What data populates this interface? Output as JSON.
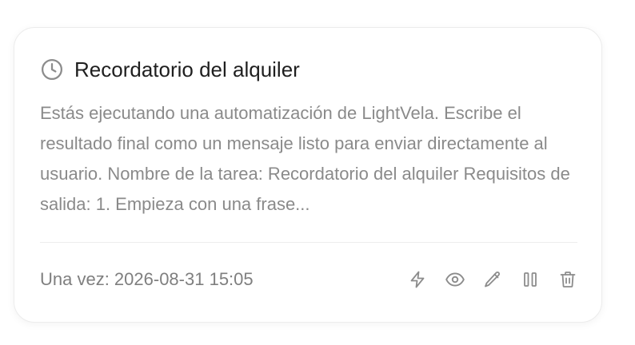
{
  "task": {
    "title": "Recordatorio del alquiler",
    "description": "Estás ejecutando una automatización de LightVela. Escribe el resultado final como un mensaje listo para enviar directamente al usuario. Nombre de la tarea: Recordatorio del alquiler Requisitos de salida: 1. Empieza con una frase...",
    "schedule": "Una vez: 2026-08-31 15:05",
    "title_icon": "clock-icon"
  },
  "actions": [
    {
      "icon": "bolt-icon"
    },
    {
      "icon": "eye-icon"
    },
    {
      "icon": "pencil-icon"
    },
    {
      "icon": "pause-icon"
    },
    {
      "icon": "trash-icon"
    }
  ],
  "colors": {
    "title": "#1f1f1f",
    "muted": "#8a8a8a",
    "icon": "#8c8c8c",
    "border": "#ececec"
  }
}
